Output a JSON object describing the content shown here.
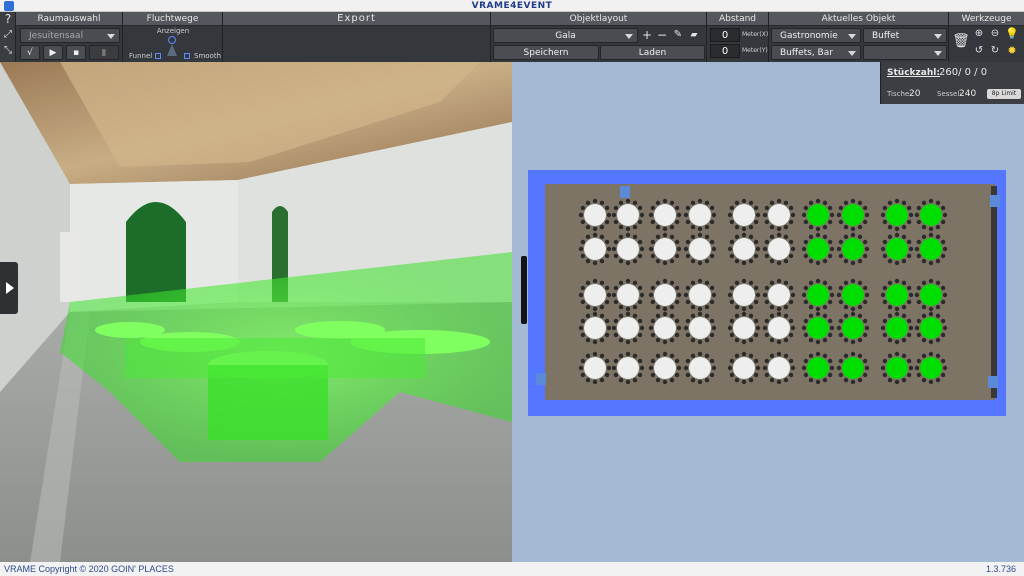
{
  "app": {
    "title": "VRAME4EVENT"
  },
  "toolbar": {
    "raumauswahl": {
      "header": "Raumauswahl",
      "room": "Jesuitensaal"
    },
    "fluchtwege": {
      "header": "Fluchtwege",
      "show_label": "Anzeigen",
      "funnel_label": "Funnel",
      "smooth_label": "Smooth"
    },
    "export": {
      "header": "Export"
    },
    "objektlayout": {
      "header": "Objektlayout",
      "layout": "Gala",
      "save_label": "Speichern",
      "load_label": "Laden"
    },
    "abstand": {
      "header": "Abstand",
      "x_value": "0",
      "x_label": "Meter(X)",
      "y_value": "0",
      "y_label": "Meter(Y)"
    },
    "aktuelles": {
      "header": "Aktuelles Objekt",
      "category": "Gastronomie",
      "type": "Buffet",
      "subcategory": "Buffets, Bar",
      "variant": ""
    },
    "werkzeuge": {
      "header": "Werkzeuge"
    }
  },
  "stats": {
    "count_label": "Stückzahl:",
    "count_values": "260/ 0 / 0",
    "tables_label": "Tische:",
    "tables_value": "20",
    "chairs_label": "Sessel:",
    "chairs_value": "240",
    "limit_label": "8p Limit"
  },
  "footer": {
    "copyright": "VRAME Copyright © 2020 GOIN' PLACES",
    "version": "1.3.736"
  },
  "plan": {
    "rows": 5,
    "cols": 10,
    "highlight_cols": [
      6,
      7,
      8,
      9
    ],
    "colors": {
      "hall": "#5577ff",
      "floor": "#7d7466",
      "table_white": "#eeeeee",
      "table_green": "#00dd00",
      "chair": "#2b2b2b"
    }
  }
}
